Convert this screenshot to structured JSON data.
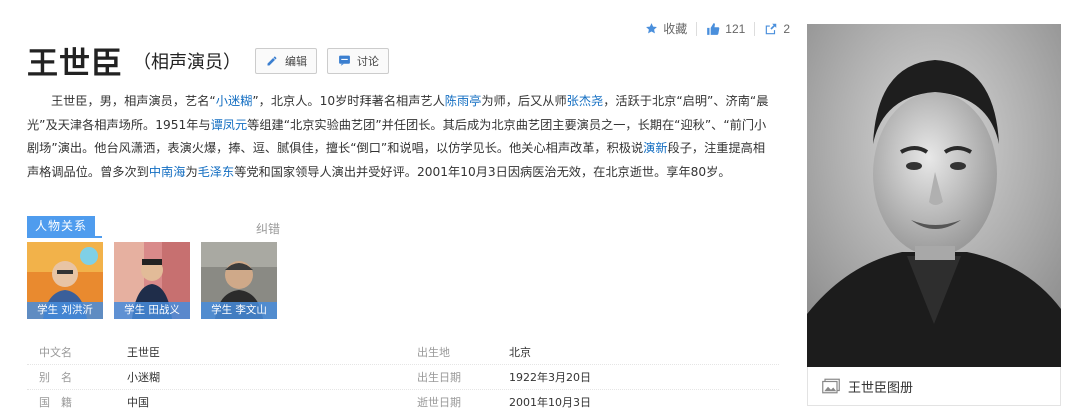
{
  "topbar": {
    "favorite_label": "收藏",
    "like_count": "121",
    "share_count": "2"
  },
  "title": {
    "name": "王世臣",
    "subtitle": "（相声演员）",
    "edit_label": "编辑",
    "discuss_label": "讨论"
  },
  "summary": {
    "s1": "王世臣，男，相声演员，艺名“",
    "l1": "小迷糊",
    "s2": "”，北京人。10岁时拜著名相声艺人",
    "l2": "陈雨亭",
    "s3": "为师，后又从师",
    "l3": "张杰尧",
    "s4": "，活跃于北京“启明”、济南“晨光”及天津各相声场所。1951年与",
    "l4": "谭凤元",
    "s5": "等组建“北京实验曲艺团”并任团长。其后成为北京曲艺团主要演员之一，长期在“迎秋”、“前门小剧场”演出。他台风潇洒，表演火爆，捧、逗、腻俱佳，擅长“倒口”和说唱，以仿学见长。他关心相声改革，积极说",
    "l5": "演新",
    "s6": "段子，注重提高相声格调品位。曾多次到",
    "l6": "中南海",
    "s7": "为",
    "l7": "毛泽东",
    "s8": "等党和国家领导人演出并受好评。2001年10月3日因病医治无效，在北京逝世。享年80岁。"
  },
  "relations": {
    "tab_label": "人物关系",
    "correction_label": "纠错",
    "people": [
      {
        "caption": "学生 刘洪沂"
      },
      {
        "caption": "学生 田战义"
      },
      {
        "caption": "学生 李文山"
      }
    ]
  },
  "basic_info": [
    {
      "k1": "中文名",
      "v1": "王世臣",
      "k2": "出生地",
      "v2": "北京"
    },
    {
      "k1": "别　名",
      "v1": "小迷糊",
      "k2": "出生日期",
      "v2": "1922年3月20日"
    },
    {
      "k1": "国　籍",
      "v1": "中国",
      "k2": "逝世日期",
      "v2": "2001年10月3日"
    }
  ],
  "album": {
    "label": "王世臣图册"
  },
  "colors": {
    "accent": "#4f9cee",
    "link": "#136ec2"
  }
}
